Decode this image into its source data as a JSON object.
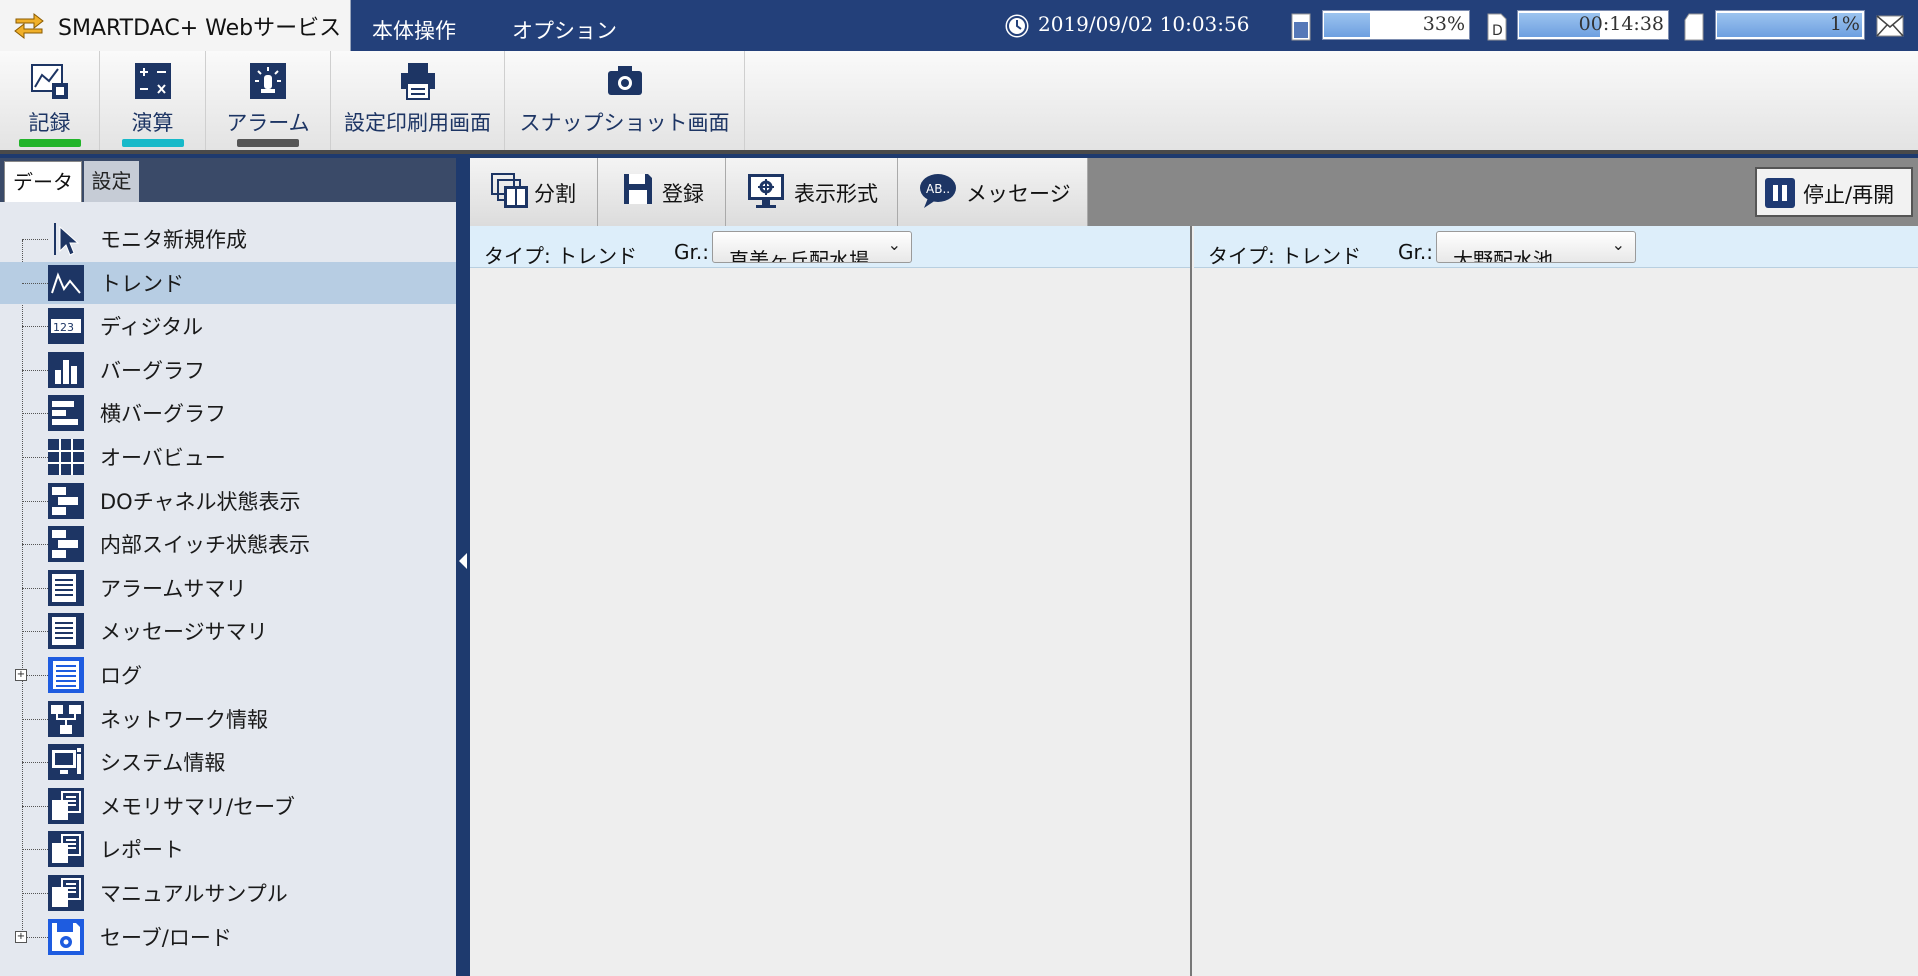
{
  "app": {
    "title": "SMARTDAC+ Webサービス"
  },
  "top_menu": {
    "main": "本体操作",
    "option": "オプション"
  },
  "status": {
    "datetime": "2019/09/02 10:03:56",
    "memory_percent": "33%",
    "memory_fraction": 0.33,
    "time_remaining": "00:14:38",
    "time_fraction": 0.55,
    "media_percent": "1%",
    "media_fraction": 0.99
  },
  "ribbon": {
    "items": [
      {
        "label": "記録",
        "indicator": "#22b42a"
      },
      {
        "label": "演算",
        "indicator": "#17b9c9"
      },
      {
        "label": "アラーム",
        "indicator": "#555555"
      },
      {
        "label": "設定印刷用画面"
      },
      {
        "label": "スナップショット画面"
      }
    ]
  },
  "sidebar": {
    "tabs": {
      "data": "データ",
      "settings": "設定"
    },
    "items": [
      {
        "label": "モニタ新規作成",
        "icon": "cursor-icon"
      },
      {
        "label": "トレンド",
        "icon": "trend-icon",
        "selected": true
      },
      {
        "label": "ディジタル",
        "icon": "digital-icon"
      },
      {
        "label": "バーグラフ",
        "icon": "bargraph-icon"
      },
      {
        "label": "横バーグラフ",
        "icon": "hbargraph-icon"
      },
      {
        "label": "オーバビュー",
        "icon": "overview-icon"
      },
      {
        "label": "DOチャネル状態表示",
        "icon": "do-channel-icon"
      },
      {
        "label": "内部スイッチ状態表示",
        "icon": "internal-switch-icon"
      },
      {
        "label": "アラームサマリ",
        "icon": "alarm-summary-icon"
      },
      {
        "label": "メッセージサマリ",
        "icon": "message-summary-icon"
      },
      {
        "label": "ログ",
        "icon": "log-icon",
        "expandable": true
      },
      {
        "label": "ネットワーク情報",
        "icon": "network-icon"
      },
      {
        "label": "システム情報",
        "icon": "system-icon"
      },
      {
        "label": "メモリサマリ/セーブ",
        "icon": "memory-icon"
      },
      {
        "label": "レポート",
        "icon": "report-icon"
      },
      {
        "label": "マニュアルサンプル",
        "icon": "manual-sample-icon"
      },
      {
        "label": "セーブ/ロード",
        "icon": "save-load-icon",
        "expandable": true
      }
    ]
  },
  "toolbar": {
    "split": "分割",
    "register": "登録",
    "display_format": "表示形式",
    "message": "メッセージ",
    "pause_resume": "停止/再開"
  },
  "panels": [
    {
      "type_label": "タイプ: トレンド",
      "gr_label": "Gr.:",
      "gr_value": "直美ヶ丘配水場"
    },
    {
      "type_label": "タイプ: トレンド",
      "gr_label": "Gr.:",
      "gr_value": "大野配水池"
    }
  ]
}
